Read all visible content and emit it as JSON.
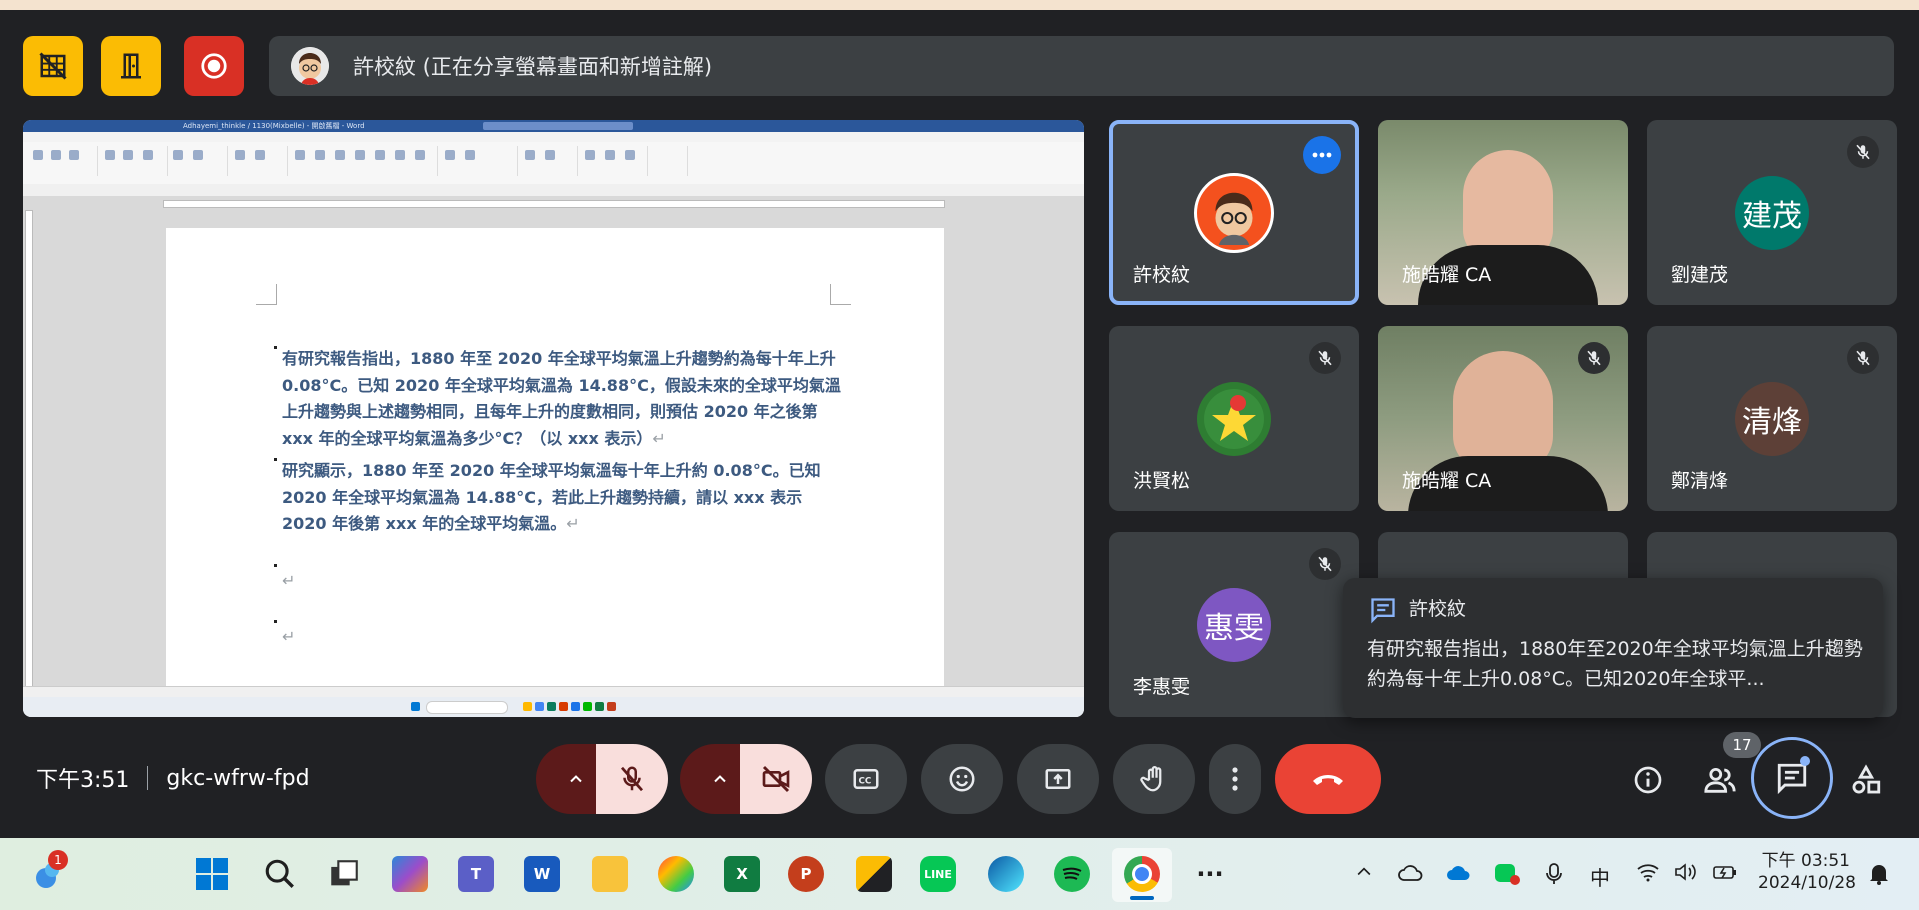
{
  "presenter_bar": {
    "text": "許校紋 (正在分享螢幕畫面和新增註解)"
  },
  "document": {
    "window_title": "Adhayemi_thinkle / 1130(Mixbelle) - 開啟舊檔 - Word",
    "paragraphs": [
      "有研究報告指出，1880 年至 2020 年全球平均氣溫上升趨勢約為每十年上升 0.08°C。已知 2020 年全球平均氣溫為 14.88°C，假設未來的全球平均氣溫上升趨勢與上述趨勢相同，且每年上升的度數相同，則預估 2020 年之後第 xxx 年的全球平均氣溫為多少°C？（以 xxx 表示）",
      "研究顯示，1880 年至 2020 年全球平均氣溫每十年上升約 0.08°C。已知 2020 年全球平均氣溫為 14.88°C，若此上升趨勢持續，請以 xxx 表示 2020 年後第 xxx 年的全球平均氣溫。"
    ],
    "para_mark": "↵"
  },
  "participants": [
    {
      "name": "許校紋",
      "type": "avatar-cartoon",
      "active": true,
      "muted": false
    },
    {
      "name": "施皓耀 CA",
      "type": "video",
      "muted": false
    },
    {
      "name": "劉建茂",
      "type": "initials",
      "initials": "建茂",
      "color": "#00796b",
      "muted": true
    },
    {
      "name": "洪賢松",
      "type": "avatar-logo",
      "muted": true
    },
    {
      "name": "施皓耀 CA",
      "type": "video",
      "muted": true
    },
    {
      "name": "鄭清烽",
      "type": "initials",
      "initials": "清烽",
      "color": "#5d4037",
      "muted": true
    },
    {
      "name": "李惠雯",
      "type": "initials",
      "initials": "惠雯",
      "color": "#7e57c2",
      "muted": true
    }
  ],
  "chat_toast": {
    "sender": "許校紋",
    "message": "有研究報告指出，1880年至2020年全球平均氣溫上升趨勢約為每十年上升0.08°C。已知2020年全球平..."
  },
  "meeting": {
    "time": "下午3:51",
    "code": "gkc-wfrw-fpd",
    "people_count": "17"
  },
  "taskbar": {
    "notification_count": "1",
    "tray_ime": "中",
    "clock_time": "下午 03:51",
    "clock_date": "2024/10/28"
  },
  "colors": {
    "accent": "#8ab4f8",
    "end_call": "#ea4335",
    "meet_bg": "#202124"
  }
}
